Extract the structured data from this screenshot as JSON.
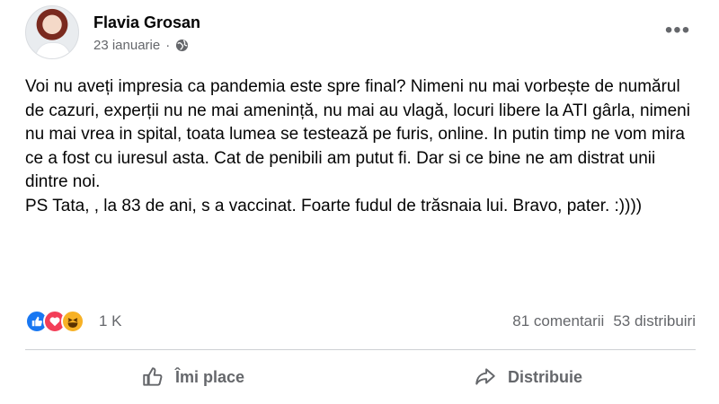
{
  "post": {
    "author": "Flavia Grosan",
    "date": "23 ianuarie",
    "separator": "·",
    "more_label": "•••",
    "text": "Voi nu aveți impresia ca pandemia este spre final? Nimeni nu mai vorbește de numărul de cazuri, experții nu ne mai amenință, nu mai au vlagă, locuri libere la ATI gârla, nimeni nu mai vrea in spital, toata lumea se testează pe furis, online. In putin timp ne vom mira ce a fost cu iuresul asta. Cat de penibili am putut fi. Dar si ce bine ne am distrat unii dintre noi.\nPS Tata, , la 83 de ani, s a vaccinat. Foarte fudul de trăsnaia lui. Bravo, pater. :))))"
  },
  "stats": {
    "reactions": [
      "like-icon",
      "love-icon",
      "haha-icon"
    ],
    "reaction_count": "1 K",
    "comments": "81 comentarii",
    "shares": "53 distribuiri"
  },
  "actions": {
    "like_label": "Îmi place",
    "share_label": "Distribuie"
  },
  "colors": {
    "like": "#1877f2",
    "love": "#f33e58",
    "haha": "#f7b125",
    "secondary_text": "#65676b"
  }
}
